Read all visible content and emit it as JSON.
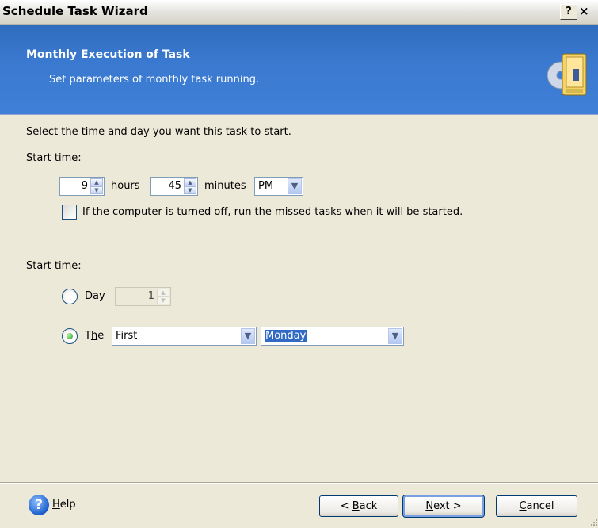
{
  "window": {
    "title": "Schedule Task Wizard",
    "help_caption": "?",
    "close_caption": "×"
  },
  "header": {
    "title": "Monthly Execution of Task",
    "subtitle": "Set parameters of monthly task running."
  },
  "body": {
    "instruction": "Select the time and day you want this task to start.",
    "start_time_label": "Start time:",
    "hours_value": "9",
    "hours_label": "hours",
    "minutes_value": "45",
    "minutes_label": "minutes",
    "ampm_value": "PM",
    "missed_checkbox_label": "If the computer is turned off, run the missed tasks when it will be started.",
    "missed_checkbox_checked": false,
    "start_time_label_2": "Start time:",
    "day_option": {
      "mnemonic": "D",
      "rest": "ay",
      "selected": false,
      "value": "1"
    },
    "the_option": {
      "pre": "T",
      "mnemonic": "h",
      "rest": "e",
      "selected": true
    },
    "ordinal_value": "First",
    "weekday_value": "Monday"
  },
  "footer": {
    "help_mnemonic": "H",
    "help_rest": "elp",
    "back_pre": "< ",
    "back_mnemonic": "B",
    "back_rest": "ack",
    "next_mnemonic": "N",
    "next_rest": "ext >",
    "cancel_mnemonic": "C",
    "cancel_rest": "ancel"
  },
  "colors": {
    "header_bg": "#3a79cf",
    "dialog_bg": "#ece9d8",
    "selection": "#316ac5",
    "radio_dot": "#21a121"
  },
  "icons": {
    "wizard": "wizard-disk-icon",
    "help": "help-icon",
    "spin_up": "spin-up-icon",
    "spin_down": "spin-down-icon",
    "dropdown": "chevron-down-icon"
  }
}
